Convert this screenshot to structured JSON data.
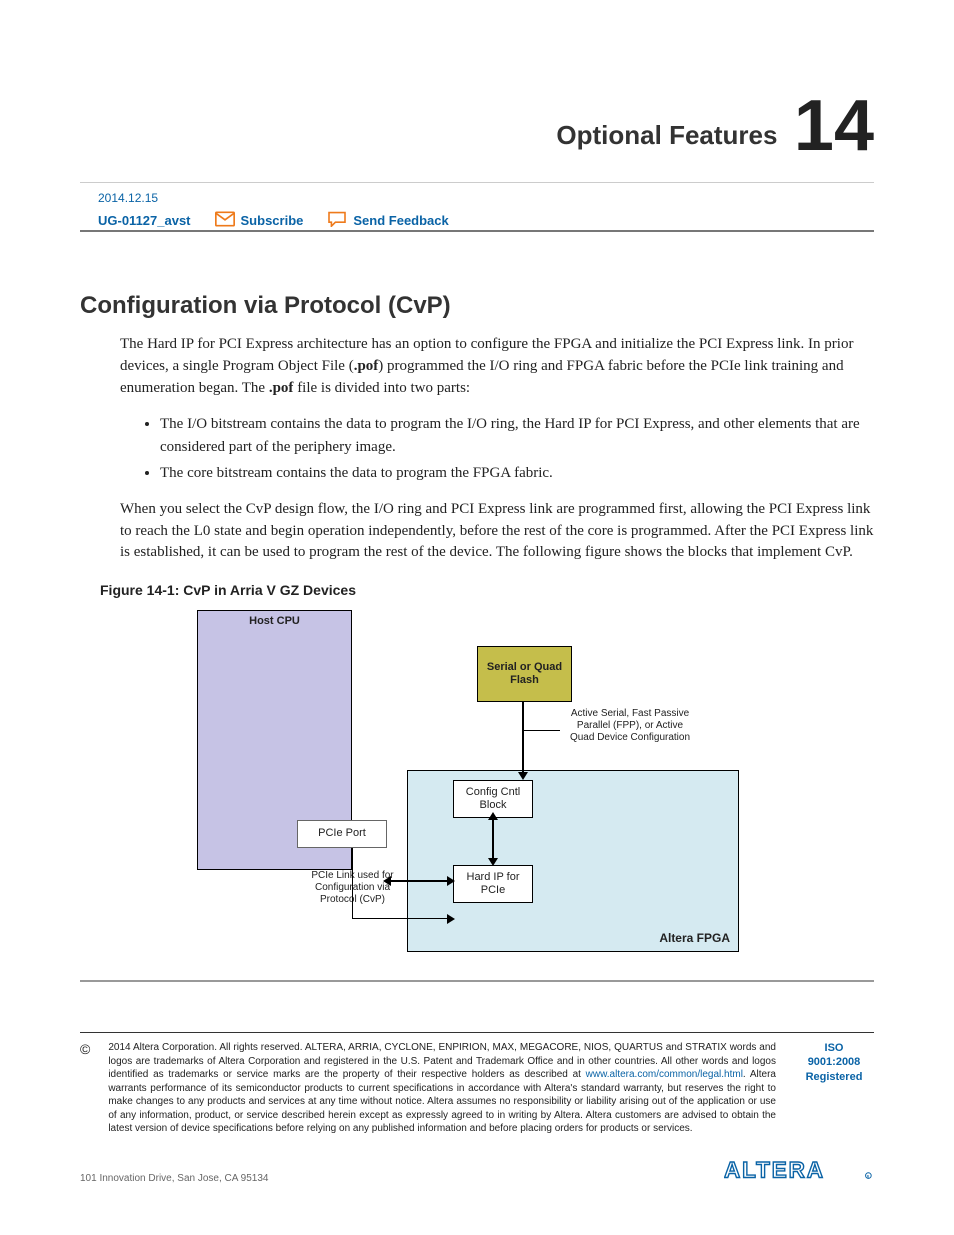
{
  "chapter": {
    "title": "Optional Features",
    "number": "14"
  },
  "meta": {
    "date": "2014.12.15",
    "doc_id": "UG-01127_avst",
    "subscribe": "Subscribe",
    "feedback": "Send Feedback"
  },
  "section": {
    "title": "Configuration via Protocol (CvP)"
  },
  "paragraphs": {
    "p1a": "The Hard IP for PCI Express architecture has an option to configure the FPGA and initialize the PCI Express link. In prior devices, a single Program Object File (",
    "p1b": ".pof",
    "p1c": ") programmed the I/O ring and FPGA fabric before the PCIe link training and enumeration began. The ",
    "p1d": ".pof",
    "p1e": " file is divided into two parts:",
    "b1": "The I/O bitstream contains the data to program the I/O ring, the Hard IP for PCI Express, and other elements that are considered part of the periphery image.",
    "b2": "The core bitstream contains the data to program the FPGA fabric.",
    "p2": "When you select the CvP design flow, the I/O ring and PCI Express link are programmed first, allowing the PCI Express link to reach the L0 state and begin operation independently, before the rest of the core is programmed. After the PCI Express link is established, it can be used to program the rest of the device. The following figure shows the blocks that implement CvP."
  },
  "figure": {
    "caption": "Figure 14-1: CvP in Arria V GZ Devices",
    "host": "Host CPU",
    "pcie_port": "PCIe Port",
    "flash": "Serial or Quad Flash",
    "config_block": "Config Cntl Block",
    "hardip": "Hard IP for  PCIe",
    "fpga_label": "Altera FPGA",
    "note_active": "Active Serial, Fast Passive Parallel (FPP), or Active Quad Device Configuration",
    "note_pcie": "PCIe Link used for Configuration via Protocol (CvP)"
  },
  "footer": {
    "text_a": "2014 Altera Corporation. All rights reserved. ALTERA, ARRIA, CYCLONE, ENPIRION, MAX, MEGACORE, NIOS, QUARTUS and STRATIX words and logos are trademarks of Altera Corporation and registered in the U.S. Patent and Trademark Office and in other countries. All other words and logos identified as trademarks or service marks are the property of their respective holders as described at ",
    "link": "www.altera.com/common/legal.html",
    "text_b": ". Altera warrants performance of its semiconductor products to current specifications in accordance with Altera's standard warranty, but reserves the right to make changes to any products and services at any time without notice. Altera assumes no responsibility or liability arising out of the application or use of any information, product, or service described herein except as expressly agreed to in writing by Altera. Altera customers are advised to obtain the latest version of device specifications before relying on any published information and before placing orders for products or services.",
    "iso1": "ISO",
    "iso2": "9001:2008",
    "iso3": "Registered",
    "addr": "101 Innovation Drive, San Jose, CA 95134"
  }
}
